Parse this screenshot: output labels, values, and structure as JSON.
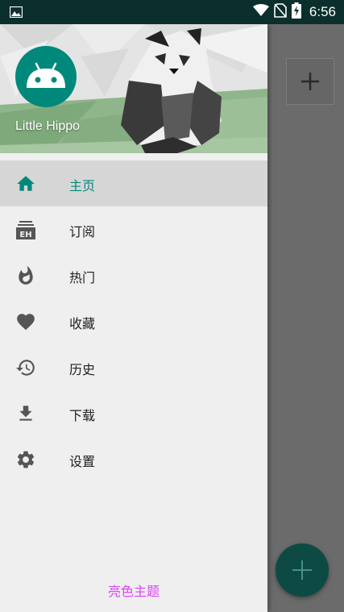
{
  "status_bar": {
    "time": "6:56",
    "icons": [
      "image-icon",
      "wifi-icon",
      "no-sim-icon",
      "battery-charging-icon"
    ]
  },
  "drawer": {
    "header": {
      "username": "Little Hippo",
      "avatar": "android-avatar-icon"
    },
    "menu": [
      {
        "label": "主页",
        "icon": "home-icon",
        "active": true
      },
      {
        "label": "订阅",
        "icon": "eh-subscribe-icon",
        "active": false
      },
      {
        "label": "热门",
        "icon": "fire-icon",
        "active": false
      },
      {
        "label": "收藏",
        "icon": "heart-icon",
        "active": false
      },
      {
        "label": "历史",
        "icon": "history-icon",
        "active": false
      },
      {
        "label": "下载",
        "icon": "download-icon",
        "active": false
      },
      {
        "label": "设置",
        "icon": "settings-icon",
        "active": false
      }
    ],
    "theme_toggle": "亮色主题"
  },
  "background_app": {
    "add_button": "plus-icon",
    "fab": "plus-icon"
  },
  "colors": {
    "accent": "#00897b",
    "status_bar": "#0a2f2c",
    "theme_link": "#e040fb"
  }
}
